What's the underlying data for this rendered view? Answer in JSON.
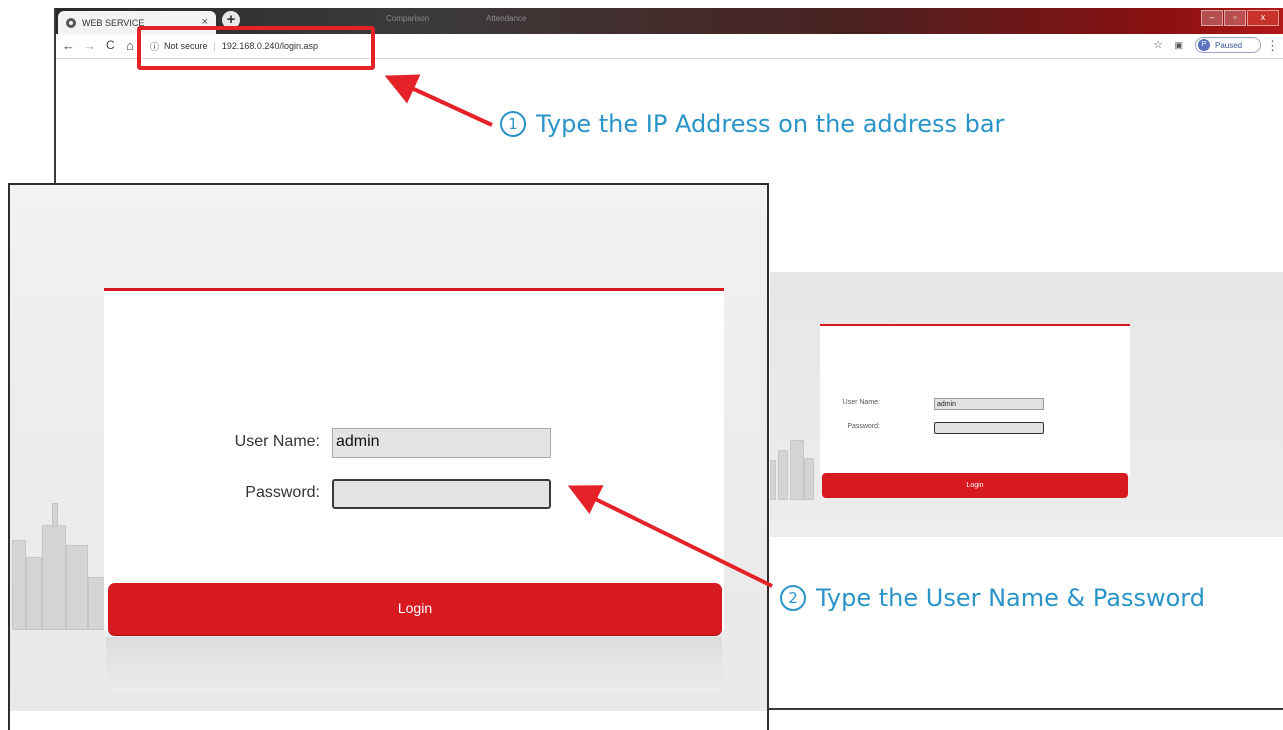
{
  "browser": {
    "tab_title": "WEB SERVICE",
    "tab_close": "×",
    "new_tab": "+",
    "background_tabs": [
      "Comparison",
      "Attendance"
    ],
    "window_controls": [
      "–",
      "▫",
      "x"
    ],
    "nav": {
      "back": "←",
      "forward": "→",
      "reload": "C",
      "home": "⌂"
    },
    "address": {
      "security_icon": "ⓘ",
      "security_text": "Not secure",
      "separator": "|",
      "url": "192.168.0.240/login.asp"
    },
    "toolbar_icons": {
      "star": "☆",
      "cast": "▣",
      "media": "≡",
      "menu": "⋮"
    },
    "profile": {
      "initial": "P",
      "status": "Paused"
    }
  },
  "login_large": {
    "username_label": "User Name:",
    "username_value": "admin",
    "password_label": "Password:",
    "password_value": "",
    "login_label": "Login"
  },
  "login_small": {
    "username_label": "User Name:",
    "username_value": "admin",
    "password_label": "Password:",
    "password_value": "",
    "login_label": "Login"
  },
  "annotations": {
    "step1": {
      "number": "1",
      "text": "Type the IP Address on the address bar"
    },
    "step2": {
      "number": "2",
      "text": "Type the User Name & Password"
    }
  },
  "colors": {
    "accent_red": "#d71920",
    "annotation_blue": "#2a94c8",
    "annotation_red": "#e42228"
  }
}
